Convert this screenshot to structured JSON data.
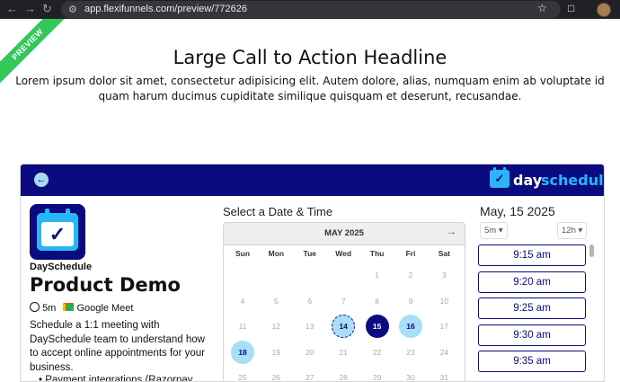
{
  "browser": {
    "url": "app.flexifunnels.com/preview/772626",
    "icons": [
      "back-arrow-icon",
      "forward-arrow-icon",
      "reload-icon",
      "site-settings-icon",
      "star-icon",
      "extensions-icon",
      "profile-avatar"
    ]
  },
  "ribbon": {
    "label": "PREVIEW",
    "color": "#34c759"
  },
  "hero": {
    "headline": "Large Call to Action Headline",
    "body": "Lorem ipsum dolor sit amet, consectetur adipisicing elit. Autem dolore, alias, numquam enim ab voluptate id quam harum ducimus cupiditate similique quisquam et deserunt, recusandae."
  },
  "widget": {
    "header_color": "#0b0b80",
    "brand": {
      "day": "day",
      "schedule": "schedule"
    },
    "event": {
      "company": "DaySchedule",
      "title": "Product Demo",
      "duration": "5m",
      "location": "Google Meet",
      "description": "Schedule a 1:1 meeting with DaySchedule team to understand how to accept online appointments for your business.",
      "bullet": "Payment integrations (Razorpay,"
    },
    "calendar": {
      "title": "Select a Date & Time",
      "month": "MAY 2025",
      "weekdays": [
        "Sun",
        "Mon",
        "Tue",
        "Wed",
        "Thu",
        "Fri",
        "Sat"
      ],
      "rows": [
        [
          "",
          "",
          "",
          "",
          "1",
          "2",
          "3"
        ],
        [
          "4",
          "5",
          "6",
          "7",
          "8",
          "9",
          "10"
        ],
        [
          "11",
          "12",
          "13",
          "14",
          "15",
          "16",
          "17"
        ],
        [
          "18",
          "19",
          "20",
          "21",
          "22",
          "23",
          "24"
        ],
        [
          "25",
          "26",
          "27",
          "28",
          "29",
          "30",
          "31"
        ]
      ],
      "available_days": [
        "14",
        "15",
        "16",
        "18"
      ],
      "today": "14",
      "selected": "15"
    },
    "slots": {
      "date": "May, 15 2025",
      "interval": "5m",
      "clock": "12h",
      "times": [
        "9:15 am",
        "9:20 am",
        "9:25 am",
        "9:30 am",
        "9:35 am"
      ]
    }
  }
}
